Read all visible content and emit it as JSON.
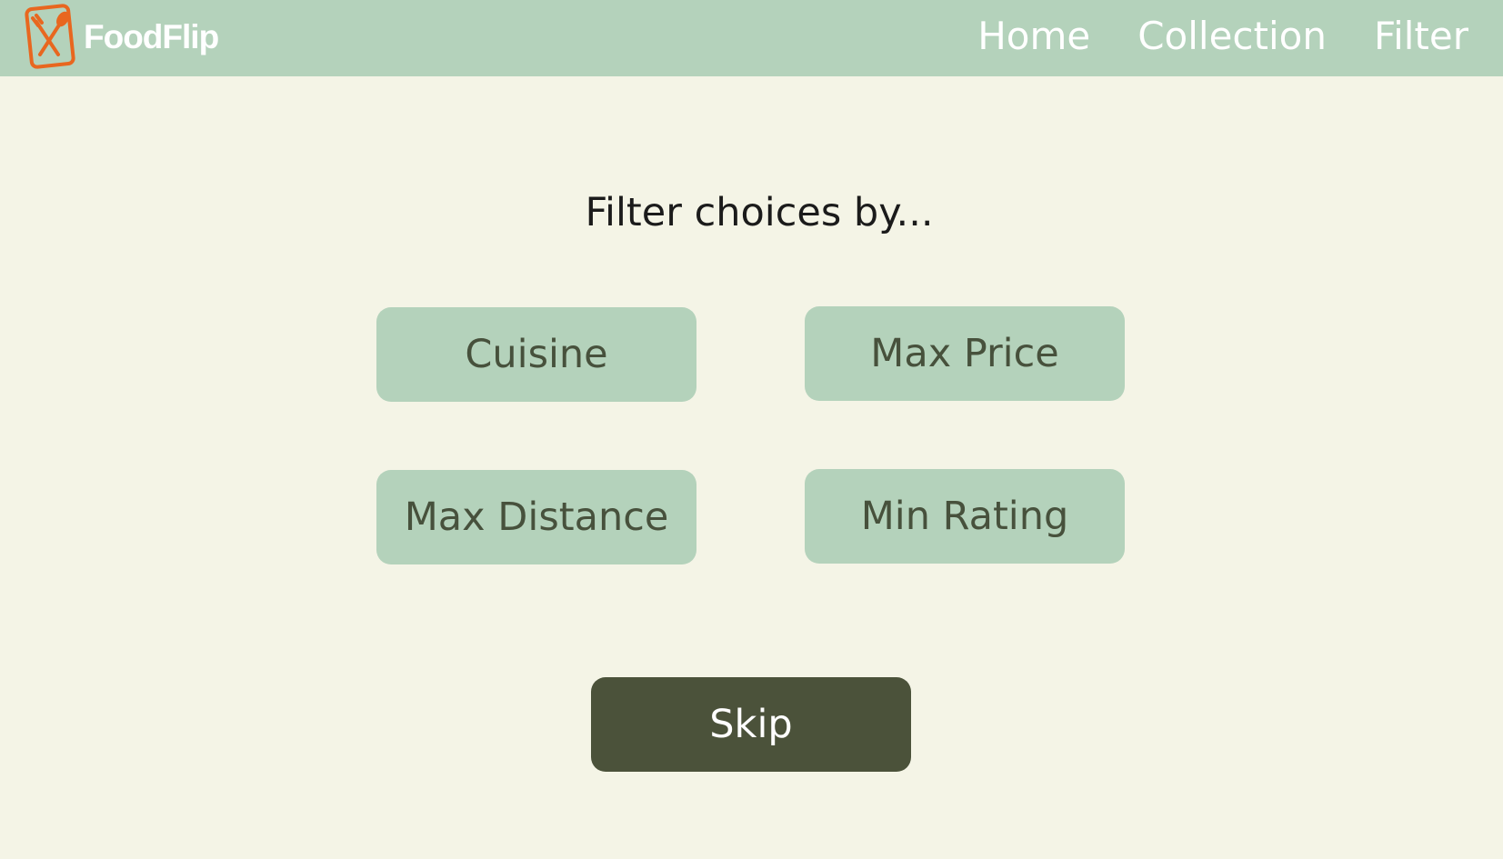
{
  "brand": {
    "name": "FoodFlip",
    "logo_icon": "fork-spoon-icon",
    "accent_color": "#e8671f"
  },
  "nav": {
    "items": [
      {
        "label": "Home"
      },
      {
        "label": "Collection"
      },
      {
        "label": "Filter"
      }
    ]
  },
  "main": {
    "heading": "Filter choices by...",
    "filters": [
      {
        "label": "Cuisine"
      },
      {
        "label": "Max Price"
      },
      {
        "label": "Max Distance"
      },
      {
        "label": "Min Rating"
      }
    ],
    "skip_label": "Skip"
  },
  "colors": {
    "navbar_bg": "#b4d2bb",
    "page_bg": "#f4f4e6",
    "button_bg": "#b4d2bb",
    "button_text": "#47513c",
    "skip_bg": "#4b523a"
  }
}
